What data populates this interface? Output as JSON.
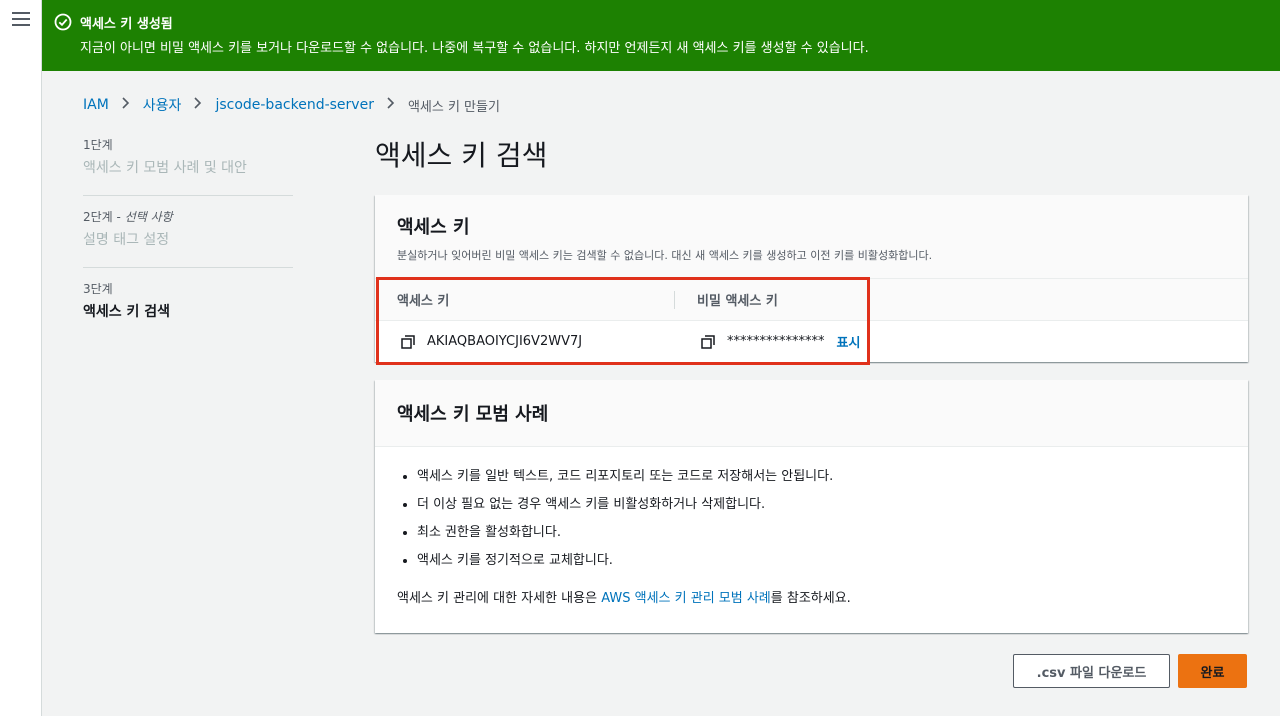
{
  "flash": {
    "title": "액세스 키 생성됨",
    "message": "지금이 아니면 비밀 액세스 키를 보거나 다운로드할 수 없습니다. 나중에 복구할 수 없습니다. 하지만 언제든지 새 액세스 키를 생성할 수 있습니다.",
    "color": "#1d8102",
    "icon": "check-circle-icon"
  },
  "breadcrumb": {
    "items": [
      "IAM",
      "사용자",
      "jscode-backend-server"
    ],
    "current": "액세스 키 만들기"
  },
  "steps": [
    {
      "num": "1단계",
      "label": "액세스 키 모범 사례 및 대안"
    },
    {
      "num": "2단계 - ",
      "optional": "선택 사항",
      "label": "설명 태그 설정"
    },
    {
      "num": "3단계",
      "label": "액세스 키 검색"
    }
  ],
  "page_title": "액세스 키 검색",
  "access_key_panel": {
    "title": "액세스 키",
    "description": "분실하거나 잊어버린 비밀 액세스 키는 검색할 수 없습니다. 대신 새 액세스 키를 생성하고 이전 키를 비활성화합니다.",
    "columns": [
      "액세스 키",
      "비밀 액세스 키"
    ],
    "access_key_id": "AKIAQBAOIYCJI6V2WV7J",
    "secret_masked": "***************",
    "show_label": "표시"
  },
  "best_practices": {
    "title": "액세스 키 모범 사례",
    "items": [
      "액세스 키를 일반 텍스트, 코드 리포지토리 또는 코드로 저장해서는 안됩니다.",
      "더 이상 필요 없는 경우 액세스 키를 비활성화하거나 삭제합니다.",
      "최소 권한을 활성화합니다.",
      "액세스 키를 정기적으로 교체합니다."
    ],
    "footer_prefix": "액세스 키 관리에 대한 자세한 내용은 ",
    "footer_link": "AWS 액세스 키 관리 모범 사례",
    "footer_suffix": "를 참조하세요."
  },
  "buttons": {
    "download_csv": ".csv 파일 다운로드",
    "done": "완료"
  },
  "colors": {
    "primary_button": "#ec7211",
    "link": "#0073bb",
    "highlight_box": "#e0311b"
  }
}
